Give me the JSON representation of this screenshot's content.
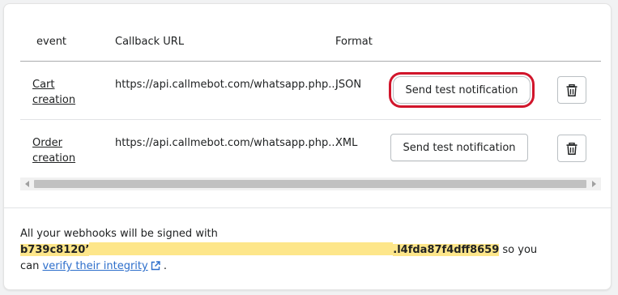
{
  "table": {
    "headers": {
      "event": "event",
      "callback_url": "Callback URL",
      "format": "Format"
    },
    "rows": [
      {
        "event_line1": "Cart",
        "event_line2": "creation",
        "url": "https://api.callmebot.com/whatsapp.php...",
        "format": "JSON",
        "test_button": "Send test notification",
        "highlighted": true
      },
      {
        "event_line1": "Order",
        "event_line2": "creation",
        "url": "https://api.callmebot.com/whatsapp.php...",
        "format": "XML",
        "test_button": "Send test notification",
        "highlighted": false
      }
    ]
  },
  "footer": {
    "text_before": "All your webhooks will be signed with",
    "key_start": "b739c8120’",
    "key_end": ".l4fda87f4dff8659",
    "text_after_key": " so you",
    "text_can": "can ",
    "link_text": "verify their integrity",
    "period": " ."
  },
  "colors": {
    "highlight_ring": "#d1152b",
    "key_highlight": "#fde68a",
    "link": "#2c6ecb"
  },
  "icons": {
    "delete": "trash-icon",
    "external": "external-link-icon"
  }
}
